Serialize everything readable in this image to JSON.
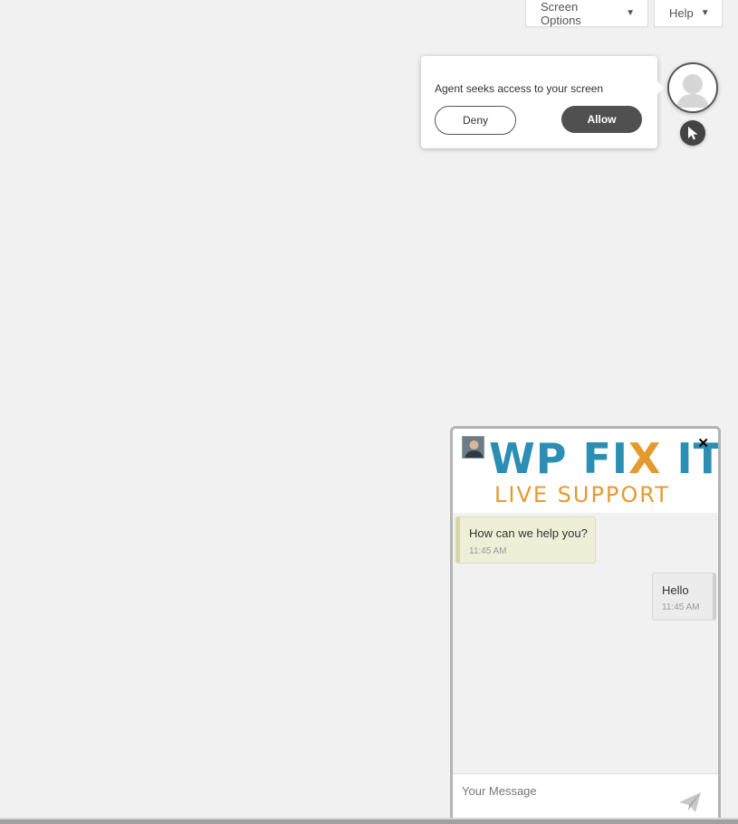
{
  "header_tabs": {
    "screen_options": "Screen Options",
    "help": "Help",
    "caret": "▼"
  },
  "screen_share": {
    "prompt": "Agent seeks access to your screen",
    "deny_label": "Deny",
    "allow_label": "Allow"
  },
  "chat": {
    "logo_title_prefix": "WP FI",
    "logo_title_x": "X",
    "logo_title_suffix": " IT",
    "logo_subtitle": "LIVE SUPPORT",
    "close_symbol": "✕",
    "messages": [
      {
        "from": "agent",
        "text": "How can we help you?",
        "time": "11:45 AM"
      },
      {
        "from": "user",
        "text": "Hello",
        "time": "11:45 AM"
      }
    ],
    "input_placeholder": "Your Message"
  },
  "colors": {
    "brand_blue": "#2a8fb3",
    "brand_orange": "#e59a2f",
    "allow_button": "#505050"
  },
  "icons": [
    "chevron-down-icon",
    "user-avatar-icon",
    "mouse-pointer-icon",
    "close-icon",
    "send-icon"
  ]
}
